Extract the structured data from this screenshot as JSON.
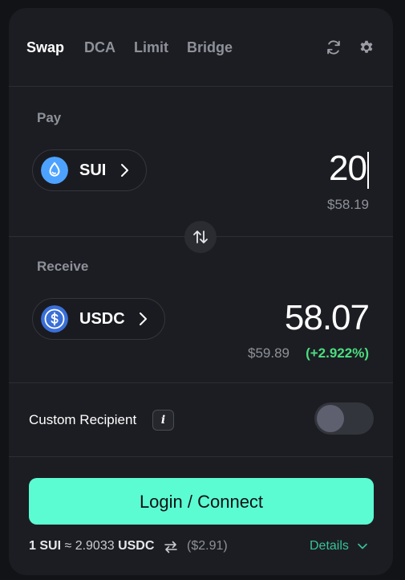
{
  "tabs": [
    {
      "label": "Swap",
      "active": true
    },
    {
      "label": "DCA",
      "active": false
    },
    {
      "label": "Limit",
      "active": false
    },
    {
      "label": "Bridge",
      "active": false
    }
  ],
  "toolbar": {
    "refresh_icon": "refresh-icon",
    "settings_icon": "gear-icon"
  },
  "pay": {
    "label": "Pay",
    "token": {
      "symbol": "SUI",
      "icon": "sui-droplet-icon",
      "color": "#4da2ff"
    },
    "amount": "20",
    "usd": "$58.19"
  },
  "receive": {
    "label": "Receive",
    "token": {
      "symbol": "USDC",
      "icon": "usdc-dollar-icon",
      "color": "#3a6fd8"
    },
    "amount": "58.07",
    "usd": "$59.89",
    "change": "(+2.922%)",
    "change_color": "#4ade80"
  },
  "recipient": {
    "label": "Custom Recipient",
    "info": "i",
    "enabled": false
  },
  "connect_label": "Login / Connect",
  "footer": {
    "rate_prefix": "1 SUI",
    "rate_eq": " ≈ 2.9033 ",
    "rate_suffix": "USDC",
    "rate_usd": "($2.91)",
    "details_label": "Details"
  },
  "colors": {
    "accent": "#5cfcd3",
    "background": "#1c1d22"
  }
}
